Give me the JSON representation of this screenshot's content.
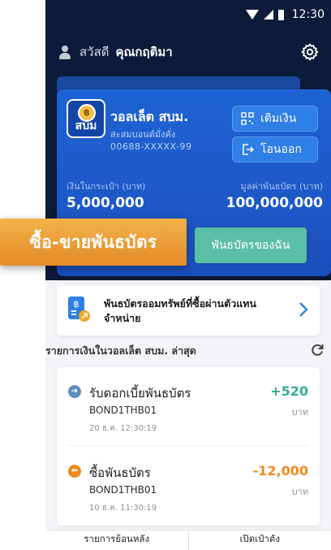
{
  "status_bar": {
    "time": "12:30"
  },
  "header": {
    "greeting": "สวัสดี",
    "name": "คุณกฤติมา"
  },
  "wallet": {
    "logo_text": "สบม",
    "name": "วอลเล็ต สบม.",
    "subtitle": "สะสมบอนด์มั่งคั่ง",
    "account": "00688-XXXXX-99",
    "topup_label": "เติมเงิน",
    "transfer_label": "โอนออก",
    "balance_label": "เงินในกระเป๋า (บาท)",
    "balance_value": "5,000,000",
    "bond_label": "มูลค่าพันธบัตร (บาท)",
    "bond_value": "100,000,000",
    "my_bonds_label": "พันธบัตรของฉัน"
  },
  "banner": {
    "label": "ซื้อ-ขายพันธบัตร"
  },
  "agent": {
    "label": "พันธบัตรออมทรัพย์ที่ซื้อผ่านตัวแทนจำหน่าย"
  },
  "transactions": {
    "section_title": "รายการเงินในวอลเล็ต สบม. ล่าสุด",
    "items": [
      {
        "title": "รับดอกเบี้ยพันธบัตร",
        "code": "BOND1THB01",
        "time": "20 ธ.ค. 12:30:19",
        "amount": "+520",
        "unit": "บาท",
        "color": "#2fae8f",
        "dot_color": "#5f8fbf"
      },
      {
        "title": "ซื้อพันธบัตร",
        "code": "BOND1THB01",
        "time": "10 ธ.ค. 11:30:19",
        "amount": "-12,000",
        "unit": "บาท",
        "color": "#f08a1c",
        "dot_color": "#f08a1c"
      }
    ]
  },
  "bottom_nav": {
    "history": "รายการย้อนหลัง",
    "open_account": "เปิดเป๋าตัง"
  },
  "colors": {
    "header_bg": "#0d1b3a",
    "card_blue": "#1e58c7",
    "accent_green": "#5bbfa5",
    "banner_orange": "#e48b28"
  }
}
